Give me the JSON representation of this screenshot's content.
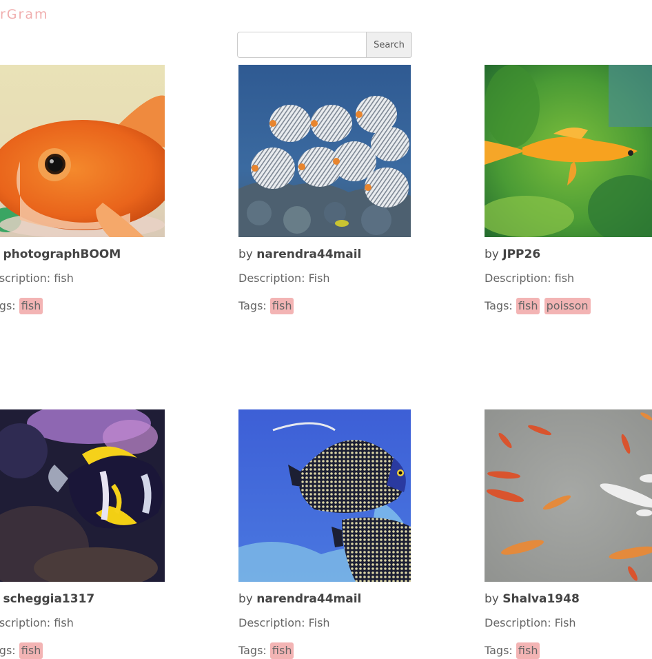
{
  "app": {
    "logo_text": "rGram"
  },
  "search": {
    "value": "",
    "placeholder": "",
    "button_label": "Search"
  },
  "labels": {
    "by": "by",
    "description": "Description:",
    "tags": "Tags:"
  },
  "cards": [
    {
      "author": "photographBOOM",
      "by_visible": "y",
      "description_label_visible": "escription:",
      "description": "fish",
      "tags_label_visible": "ags:",
      "tags": [
        "fish"
      ]
    },
    {
      "author": "narendra44mail",
      "by_visible": "by",
      "description_label_visible": "Description:",
      "description": "Fish",
      "tags_label_visible": "Tags:",
      "tags": [
        "fish"
      ]
    },
    {
      "author": "JPP26",
      "by_visible": "by",
      "description_label_visible": "Description:",
      "description": "fish",
      "tags_label_visible": "Tags:",
      "tags": [
        "fish",
        "poisson"
      ]
    },
    {
      "author": "scheggia1317",
      "by_visible": "y",
      "description_label_visible": "escription:",
      "description": "fish",
      "tags_label_visible": "ags:",
      "tags": [
        "fish"
      ]
    },
    {
      "author": "narendra44mail",
      "by_visible": "by",
      "description_label_visible": "Description:",
      "description": "Fish",
      "tags_label_visible": "Tags:",
      "tags": [
        "fish"
      ]
    },
    {
      "author": "Shalva1948",
      "by_visible": "by",
      "description_label_visible": "Description:",
      "description": "Fish",
      "tags_label_visible": "Tags:",
      "tags": [
        "fish"
      ]
    }
  ],
  "colors": {
    "logo": "#f0aeae",
    "tag_background": "#f3b4b4",
    "text": "#555555"
  }
}
